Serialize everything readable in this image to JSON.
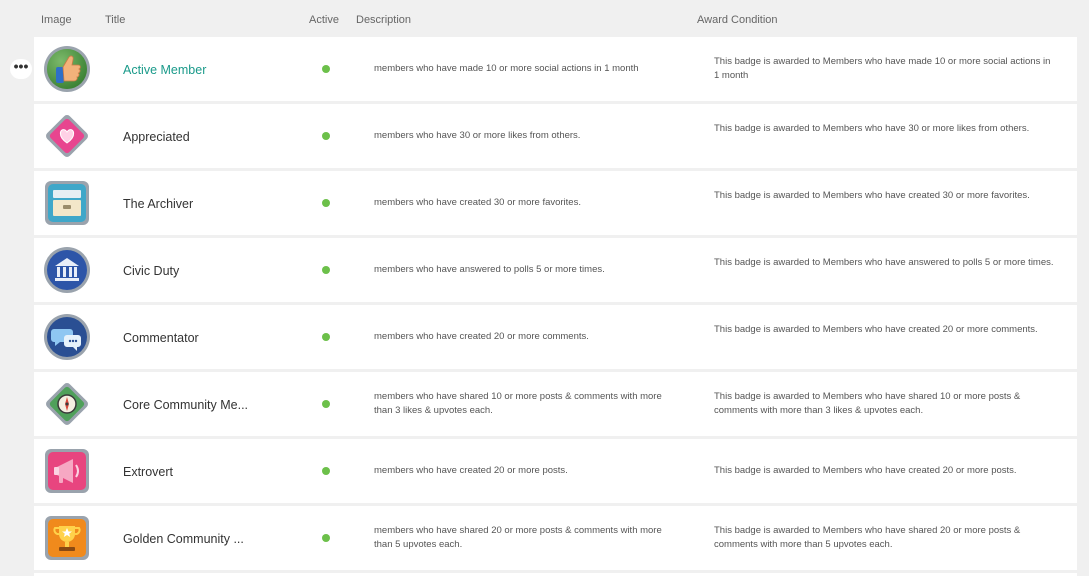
{
  "columns": {
    "image": "Image",
    "title": "Title",
    "active": "Active",
    "description": "Description",
    "award_condition": "Award Condition"
  },
  "row_actions": {
    "more_label": "•••"
  },
  "accent_color": "#1a9a8a",
  "active_color": "#6cc04a",
  "badges": [
    {
      "icon": "thumbs-up-badge-icon",
      "title": "Active Member",
      "active": true,
      "description": "members who have made 10 or more social actions in 1 month",
      "award_condition": "This badge is awarded to Members who have made 10 or more social actions in 1 month"
    },
    {
      "icon": "heart-diamond-badge-icon",
      "title": "Appreciated",
      "active": true,
      "description": "members who have 30 or more likes from others.",
      "award_condition": "This badge is awarded to Members who have 30 or more likes from others."
    },
    {
      "icon": "file-cabinet-badge-icon",
      "title": "The Archiver",
      "active": true,
      "description": "members who have created 30 or more favorites.",
      "award_condition": "This badge is awarded to Members who have created 30 or more favorites."
    },
    {
      "icon": "civic-building-badge-icon",
      "title": "Civic Duty",
      "active": true,
      "description": "members who have answered to polls 5 or more times.",
      "award_condition": "This badge is awarded to Members who have answered to polls 5 or more times."
    },
    {
      "icon": "speech-bubbles-badge-icon",
      "title": "Commentator",
      "active": true,
      "description": "members who have created 20 or more comments.",
      "award_condition": "This badge is awarded to Members who have created 20 or more comments."
    },
    {
      "icon": "compass-badge-icon",
      "title": "Core Community Me...",
      "active": true,
      "description": "members who have shared 10 or more posts & comments with more than 3 likes & upvotes each.",
      "award_condition": "This badge is awarded to Members who have shared 10 or more posts & comments with more than 3 likes & upvotes each."
    },
    {
      "icon": "megaphone-badge-icon",
      "title": "Extrovert",
      "active": true,
      "description": "members who have created 20 or more posts.",
      "award_condition": "This badge is awarded to Members who have created 20 or more posts."
    },
    {
      "icon": "trophy-badge-icon",
      "title": "Golden Community ...",
      "active": true,
      "description": "members who have shared 20 or more posts & comments with more than 5 upvotes each.",
      "award_condition": "This badge is awarded to Members who have shared 20 or more posts & comments with more than 5 upvotes each."
    }
  ]
}
